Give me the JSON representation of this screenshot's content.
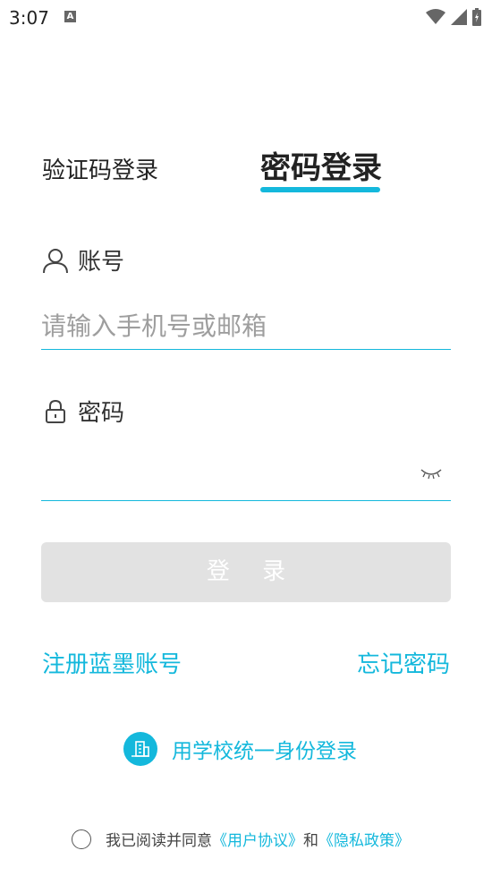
{
  "status": {
    "time": "3:07",
    "a_badge": "A"
  },
  "tabs": {
    "sms": "验证码登录",
    "password": "密码登录"
  },
  "account": {
    "label": "账号",
    "placeholder": "请输入手机号或邮箱",
    "value": ""
  },
  "password": {
    "label": "密码",
    "value": ""
  },
  "login": {
    "label": "登 录"
  },
  "links": {
    "register": "注册蓝墨账号",
    "forgot": "忘记密码"
  },
  "school": {
    "label": "用学校统一身份登录"
  },
  "agreement": {
    "prefix": "我已阅读并同意",
    "user_agreement": "《用户协议》",
    "and": "和",
    "privacy": "《隐私政策》"
  },
  "colors": {
    "accent": "#14b8dc",
    "button_disabled": "#e2e2e2"
  }
}
